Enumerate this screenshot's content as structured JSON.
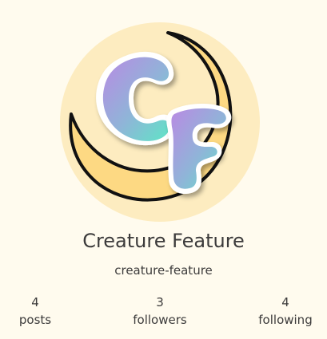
{
  "profile": {
    "display_name": "Creature Feature",
    "handle": "creature-feature",
    "avatar_logo_text": "CF",
    "colors": {
      "background": "#fffbee",
      "avatar_circle": "#fdecc0",
      "moon": "#fdd983",
      "letter_gradient_start": "#b98ae3",
      "letter_gradient_end": "#5ee5c6"
    }
  },
  "stats": {
    "posts": {
      "count": "4",
      "label": "posts"
    },
    "followers": {
      "count": "3",
      "label": "followers"
    },
    "following": {
      "count": "4",
      "label": "following"
    }
  }
}
